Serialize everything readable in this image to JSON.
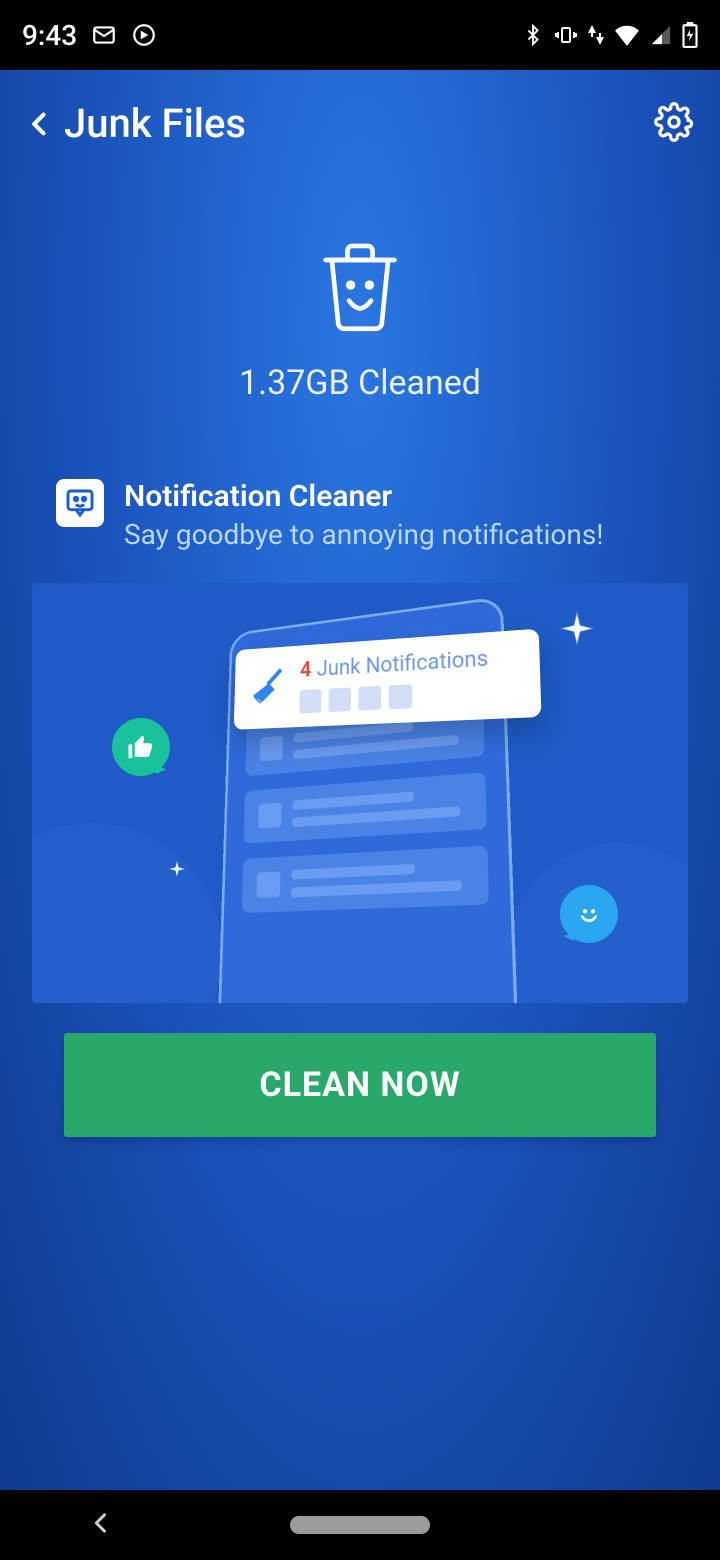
{
  "status": {
    "time": "9:43"
  },
  "header": {
    "title": "Junk Files"
  },
  "result": {
    "text": "1.37GB Cleaned"
  },
  "card": {
    "title": "Notification Cleaner",
    "subtitle": "Say goodbye to annoying notifications!",
    "notif_count": "4",
    "notif_label": "Junk Notifications"
  },
  "button": {
    "label": "CLEAN NOW"
  }
}
